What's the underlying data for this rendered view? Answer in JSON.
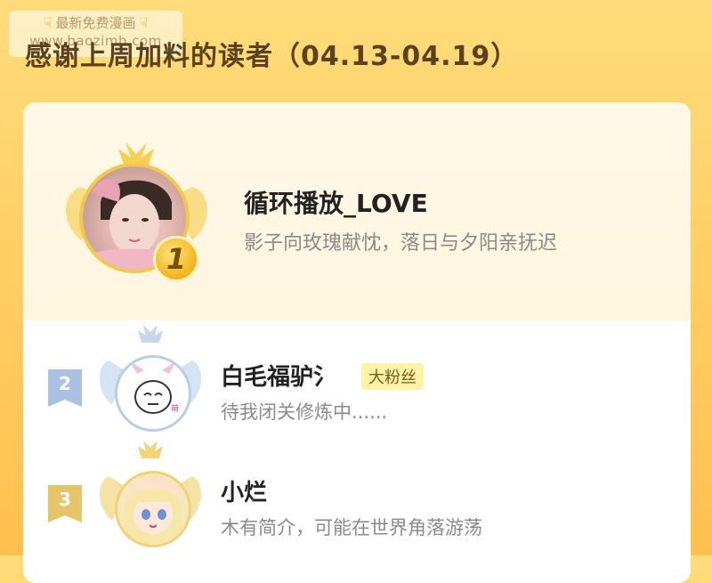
{
  "watermark": {
    "line1": "最新免费漫画",
    "line2": "www.baozimh.com",
    "hand_icon": "pointing-down-hand-icon"
  },
  "header": {
    "title": "感谢上周加料的读者（04.13-04.19）"
  },
  "top_reader": {
    "rank": "1",
    "name": "循环播放_LOVE",
    "bio": "影子向玫瑰献忱，落日与夕阳亲抚迟"
  },
  "readers": [
    {
      "rank": "2",
      "name": "白毛福驴氵",
      "badge": "大粉丝",
      "bio": "待我闭关修炼中......"
    },
    {
      "rank": "3",
      "name": "小烂",
      "bio": "木有简介，可能在世界角落游荡"
    }
  ],
  "colors": {
    "background": "#ffcf66",
    "gold": "#f4c84a",
    "silver": "#b8cde8",
    "rank2_badge": "#a9c2e4",
    "rank3_badge": "#e6c46a",
    "fan_badge": "#fff3a8"
  }
}
